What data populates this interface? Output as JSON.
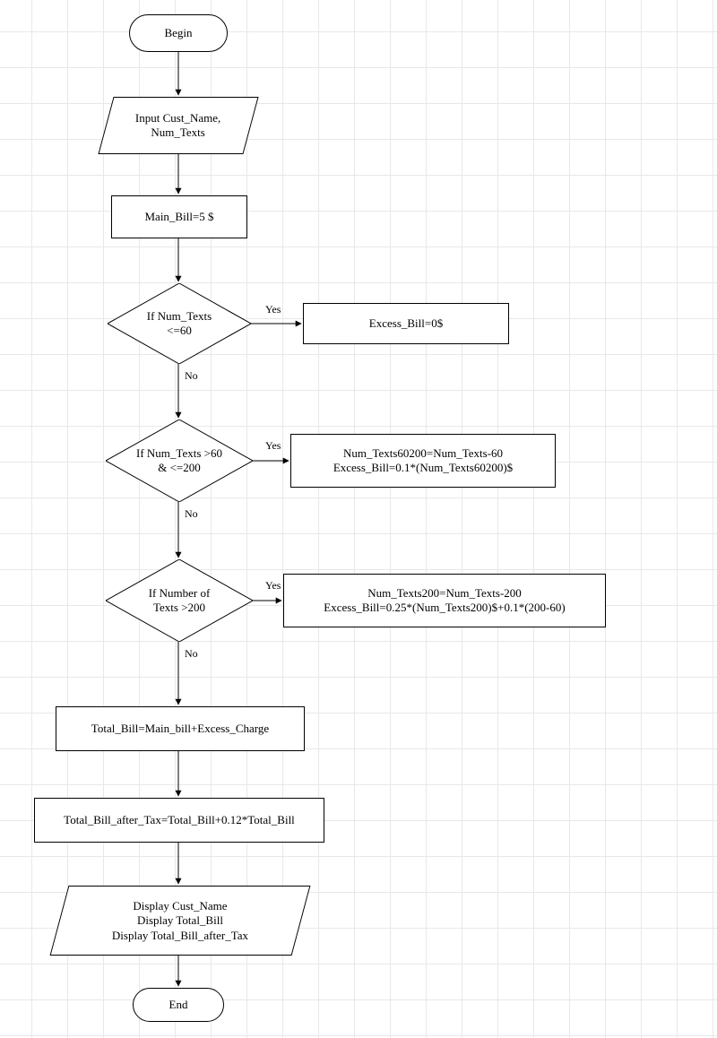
{
  "nodes": {
    "begin": "Begin",
    "input": "Input Cust_Name,\nNum_Texts",
    "mainbill": "Main_Bill=5 $",
    "cond1": "If Num_Texts\n<=60",
    "act1": "Excess_Bill=0$",
    "cond2": "If Num_Texts >60\n& <=200",
    "act2": "Num_Texts60200=Num_Texts-60\nExcess_Bill=0.1*(Num_Texts60200)$",
    "cond3": "If Number of\nTexts >200",
    "act3": "Num_Texts200=Num_Texts-200\nExcess_Bill=0.25*(Num_Texts200)$+0.1*(200-60)",
    "total": "Total_Bill=Main_bill+Excess_Charge",
    "tax": "Total_Bill_after_Tax=Total_Bill+0.12*Total_Bill",
    "display": "Display Cust_Name\nDisplay Total_Bill\nDisplay Total_Bill_after_Tax",
    "end": "End"
  },
  "labels": {
    "yes": "Yes",
    "no": "No"
  }
}
